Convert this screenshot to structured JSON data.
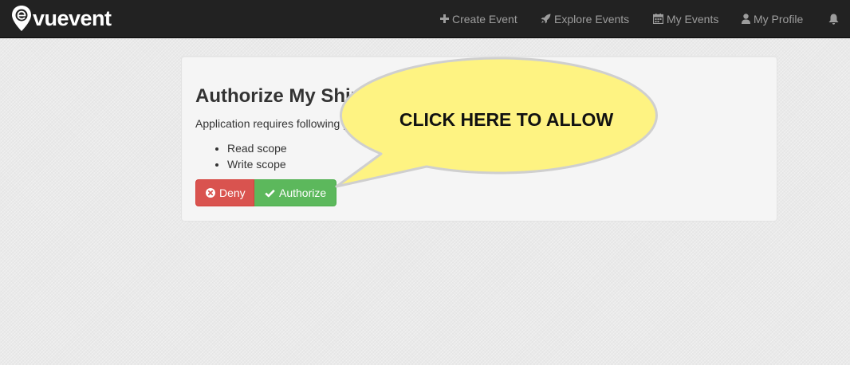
{
  "navbar": {
    "brand": "vuevent",
    "items": [
      {
        "label": "Create Event",
        "icon": "plus-icon"
      },
      {
        "label": "Explore Events",
        "icon": "rocket-icon"
      },
      {
        "label": "My Events",
        "icon": "calendar-icon"
      },
      {
        "label": "My Profile",
        "icon": "user-icon"
      }
    ],
    "notifications_icon": "bell-icon"
  },
  "dialog": {
    "title": "Authorize My Shinv",
    "description": "Application requires following p",
    "scopes": [
      "Read scope",
      "Write scope"
    ],
    "deny_label": "Deny",
    "authorize_label": "Authorize"
  },
  "callout": {
    "text": "CLICK HERE TO ALLOW"
  },
  "colors": {
    "navbar": "#222222",
    "nav_text": "#9d9d9d",
    "deny": "#d9534f",
    "authorize": "#5cb85c",
    "callout_fill": "#fef382"
  }
}
